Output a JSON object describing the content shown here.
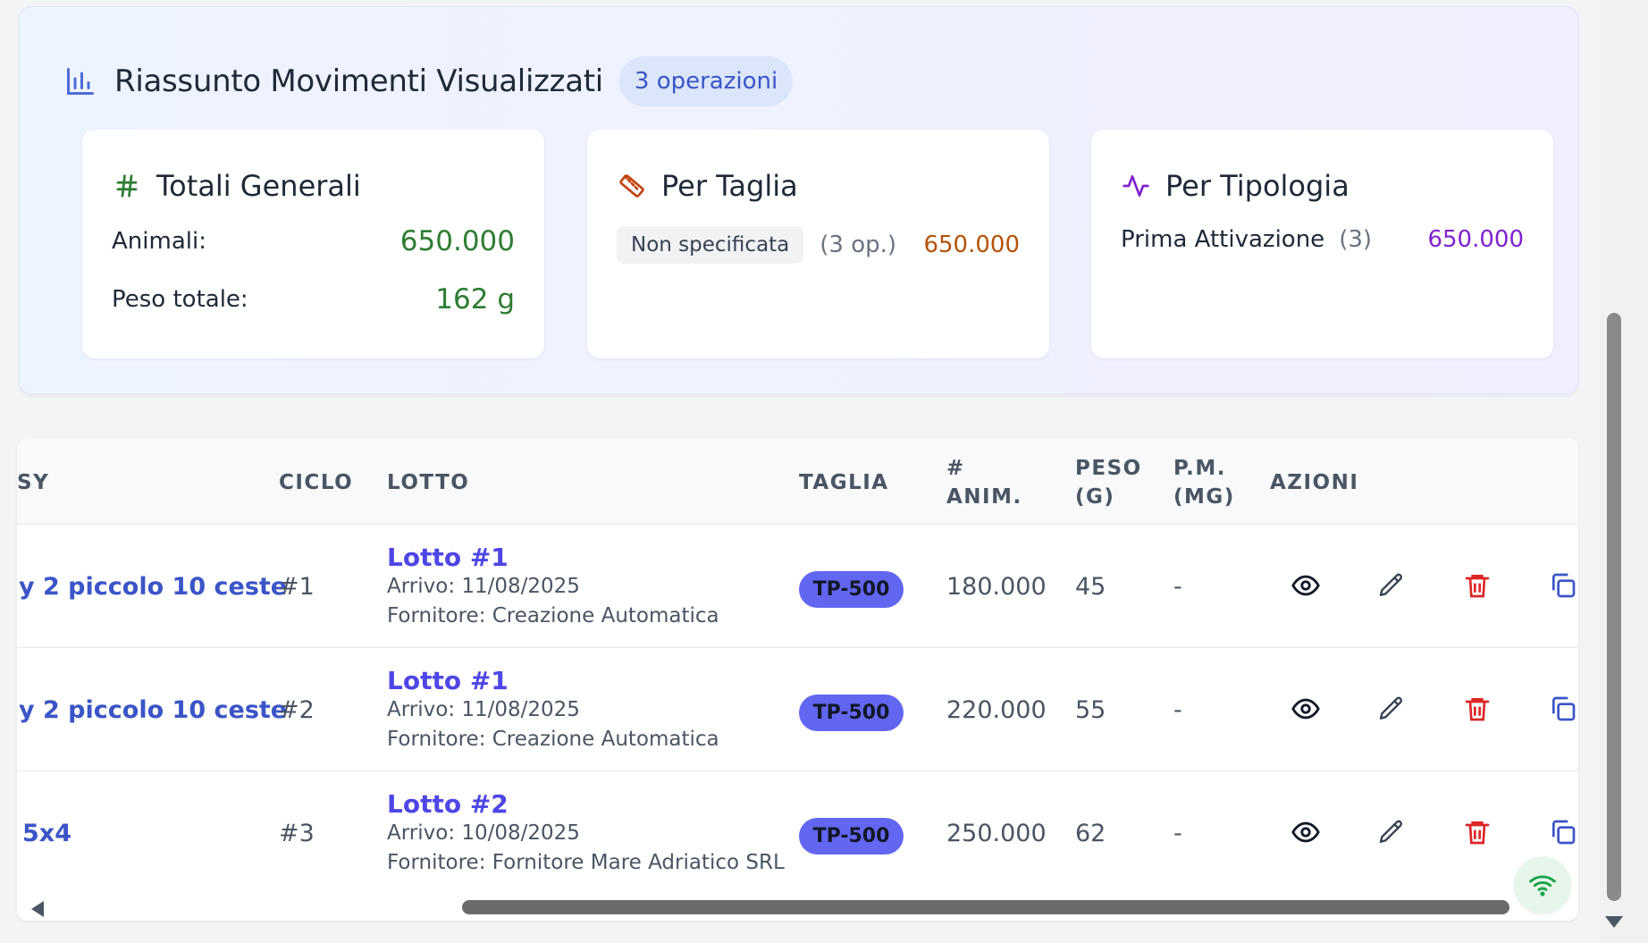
{
  "summary": {
    "title": "Riassunto Movimenti Visualizzati",
    "ops_badge": "3 operazioni",
    "totals": {
      "title": "Totali Generali",
      "animals_label": "Animali:",
      "animals_value": "650.000",
      "weight_label": "Peso totale:",
      "weight_value": "162 g"
    },
    "by_size": {
      "title": "Per Taglia",
      "tag": "Non specificata",
      "count": "(3 op.)",
      "value": "650.000"
    },
    "by_type": {
      "title": "Per Tipologia",
      "label": "Prima Attivazione",
      "count": "(3)",
      "value": "650.000"
    }
  },
  "table": {
    "headers": {
      "col0": "SY",
      "ciclo": "CICLO",
      "lotto": "LOTTO",
      "taglia": "TAGLIA",
      "anim_1": "#",
      "anim_2": "ANIM.",
      "peso_1": "PESO",
      "peso_2": "(G)",
      "pm_1": "P.M.",
      "pm_2": "(MG)",
      "azioni": "AZIONI"
    },
    "rows": [
      {
        "col0": "y 2 piccolo 10 ceste",
        "ciclo": "#1",
        "lotto": "Lotto #1",
        "arrivo": "Arrivo: 11/08/2025",
        "fornitore": "Fornitore: Creazione Automatica",
        "taglia": "TP-500",
        "anim": "180.000",
        "peso": "45",
        "pm": "-"
      },
      {
        "col0": "y 2 piccolo 10 ceste",
        "ciclo": "#2",
        "lotto": "Lotto #1",
        "arrivo": "Arrivo: 11/08/2025",
        "fornitore": "Fornitore: Creazione Automatica",
        "taglia": "TP-500",
        "anim": "220.000",
        "peso": "55",
        "pm": "-"
      },
      {
        "col0": "5x4",
        "ciclo": "#3",
        "lotto": "Lotto #2",
        "arrivo": "Arrivo: 10/08/2025",
        "fornitore": "Fornitore: Fornitore Mare Adriatico SRL",
        "taglia": "TP-500",
        "anim": "250.000",
        "peso": "62",
        "pm": "-"
      }
    ]
  },
  "colors": {
    "green": "#2e7d32",
    "orange": "#b45309",
    "purple": "#7e22ce",
    "link": "#3b55c7",
    "badge": "#6366f1",
    "delete": "#dc2626"
  },
  "icons": [
    "bar-chart-icon",
    "hash-icon",
    "ruler-icon",
    "activity-icon",
    "eye-icon",
    "pencil-icon",
    "trash-icon",
    "copy-icon",
    "wifi-icon"
  ]
}
